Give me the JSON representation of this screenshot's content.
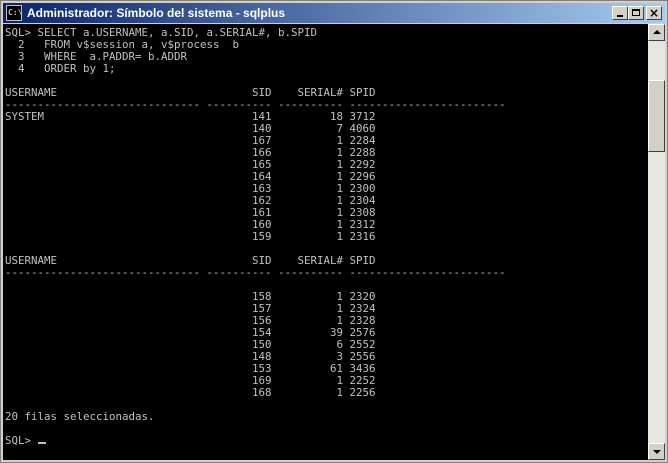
{
  "window": {
    "title": "Administrador: Símbolo del sistema - sqlplus",
    "icon_text": "C:\\",
    "icon": "cmd-icon",
    "buttons": {
      "minimize": "minimize-icon",
      "maximize": "maximize-icon",
      "close": "×"
    }
  },
  "console": {
    "lines": [
      "SQL> SELECT a.USERNAME, a.SID, a.SERIAL#, b.SPID",
      "  2   FROM v$session a, v$process  b",
      "  3   WHERE  a.PADDR= b.ADDR",
      "  4   ORDER by 1;",
      "",
      "USERNAME                              SID    SERIAL# SPID",
      "------------------------------ ---------- ---------- ------------------------",
      "SYSTEM                                141         18 3712",
      "                                      140          7 4060",
      "                                      167          1 2284",
      "                                      166          1 2288",
      "                                      165          1 2292",
      "                                      164          1 2296",
      "                                      163          1 2300",
      "                                      162          1 2304",
      "                                      161          1 2308",
      "                                      160          1 2312",
      "                                      159          1 2316",
      "",
      "USERNAME                              SID    SERIAL# SPID",
      "------------------------------ ---------- ---------- ------------------------",
      "",
      "                                      158          1 2320",
      "                                      157          1 2324",
      "                                      156          1 2328",
      "                                      154         39 2576",
      "                                      150          6 2552",
      "                                      148          3 2556",
      "                                      153         61 3436",
      "                                      169          1 2252",
      "                                      168          1 2256",
      "",
      "20 filas seleccionadas.",
      ""
    ],
    "prompt": "SQL> "
  },
  "scrollbar": {
    "up": "scroll-up-arrow-icon",
    "down": "scroll-down-arrow-icon"
  },
  "colors": {
    "console_bg": "#000000",
    "console_fg": "#c0c0c0",
    "title_start": "#0a246a",
    "title_end": "#a6caf0"
  }
}
